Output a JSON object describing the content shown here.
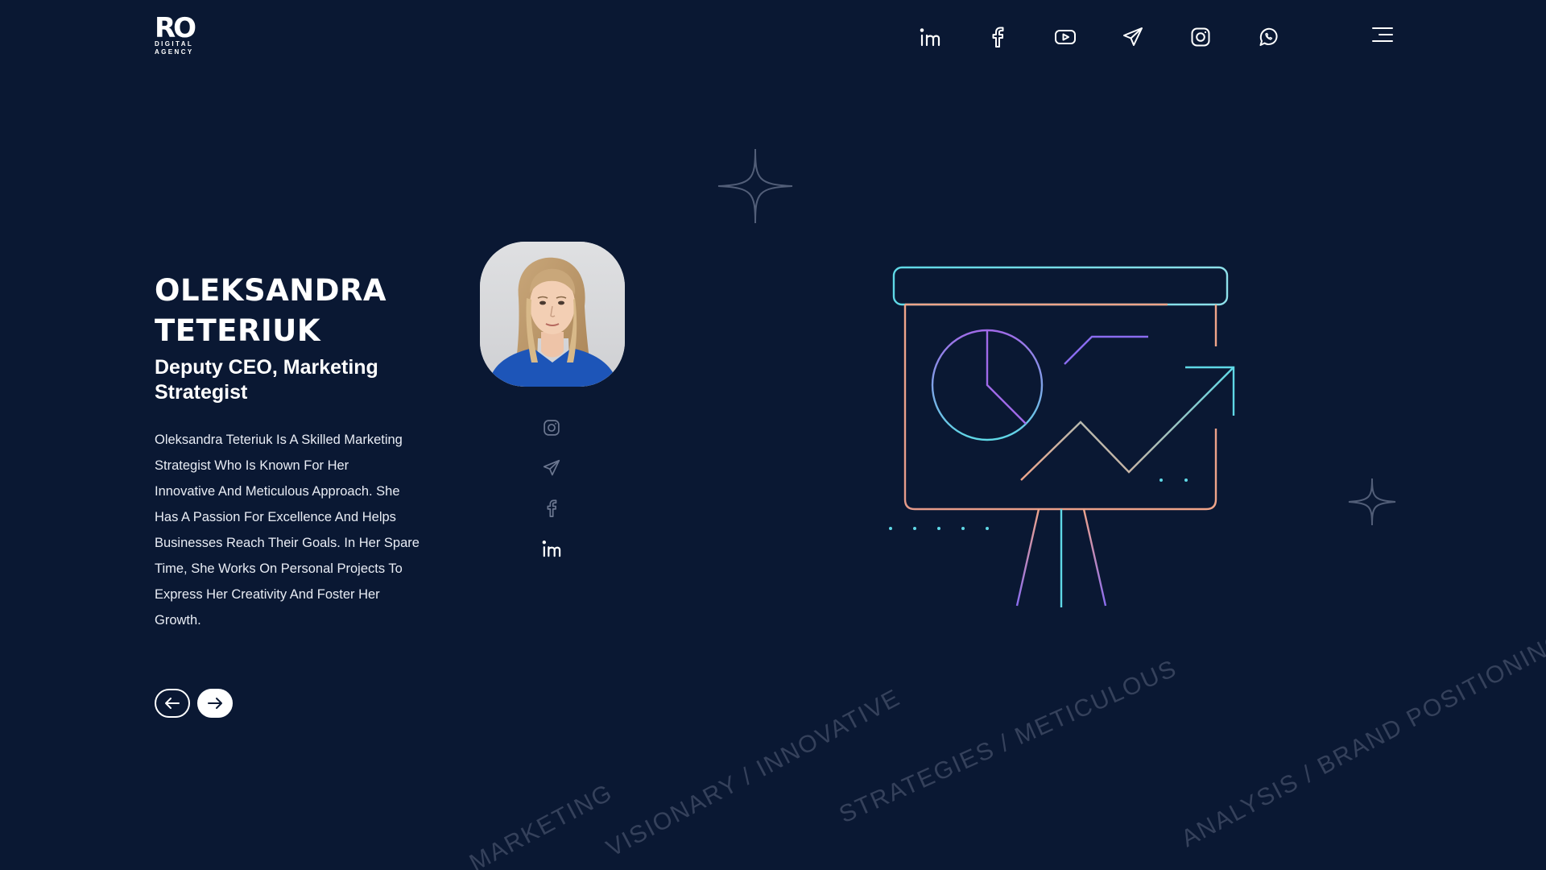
{
  "header": {
    "logo": {
      "mark": "RO",
      "line1": "DIGITAL",
      "line2": "AGENCY"
    },
    "social_icons": [
      "linkedin-icon",
      "facebook-icon",
      "youtube-icon",
      "telegram-icon",
      "instagram-icon",
      "whatsapp-icon"
    ],
    "menu_icon": "hamburger-menu-icon"
  },
  "profile": {
    "name_line1": "OLEKSANDRA",
    "name_line2": "TETERIUK",
    "role_line1": "Deputy CEO, Marketing",
    "role_line2": "Strategist",
    "bio_lines": [
      "Oleksandra Teteriuk Is A Skilled Marketing",
      "Strategist Who Is Known For Her",
      "Innovative And Meticulous Approach. She",
      "Has A Passion For Excellence And Helps",
      "Businesses Reach Their Goals. In Her Spare",
      "Time, She Works On Personal Projects To",
      "Express Her Creativity And Foster Her",
      "Growth."
    ],
    "side_socials": [
      "instagram-icon",
      "telegram-icon",
      "facebook-icon",
      "linkedin-icon"
    ]
  },
  "navigation": {
    "prev_icon": "arrow-left-icon",
    "next_icon": "arrow-right-icon"
  },
  "decor_text": {
    "w1": "MARKETING",
    "w2": "VISIONARY / INNOVATIVE",
    "w3": "STRATEGIES / METICULOUS",
    "w4": "ANALYSIS / BRAND POSITIONING RESULTS-DRIVEN / C"
  },
  "colors": {
    "background": "#0a1833",
    "accent_cyan": "#5fd8e6",
    "accent_peach": "#f0a58a",
    "accent_purple": "#8a6cf0"
  }
}
